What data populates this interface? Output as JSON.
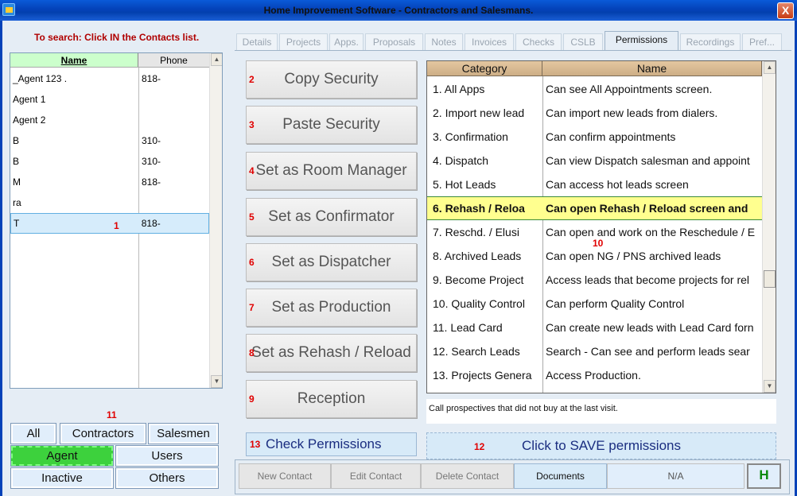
{
  "window": {
    "title": "Home Improvement Software - Contractors and Salesmans.",
    "close_label": "X"
  },
  "search_hint": "To search: Click IN the Contacts list.",
  "contacts": {
    "columns": [
      "Name",
      "Phone"
    ],
    "rows": [
      {
        "name": "_Agent 123 .",
        "phone": "818-"
      },
      {
        "name": "Agent 1",
        "phone": ""
      },
      {
        "name": "Agent 2",
        "phone": ""
      },
      {
        "name": "B",
        "phone": "310-"
      },
      {
        "name": "B",
        "phone": "310-"
      },
      {
        "name": "M",
        "phone": "818-"
      },
      {
        "name": "ra",
        "phone": ""
      },
      {
        "name": "T",
        "phone": "818-"
      }
    ],
    "selected_index": 7
  },
  "markers": {
    "m1": "1",
    "m2": "2",
    "m3": "3",
    "m4": "4",
    "m5": "5",
    "m6": "6",
    "m7": "7",
    "m8": "8",
    "m9": "9",
    "m10": "10",
    "m11": "11",
    "m12": "12",
    "m13": "13"
  },
  "filters": {
    "all": "All",
    "contractors": "Contractors",
    "salesmen": "Salesmen",
    "agent": "Agent",
    "users": "Users",
    "inactive": "Inactive",
    "others": "Others",
    "active": "Agent"
  },
  "tabs": [
    "Details",
    "Projects",
    "Apps.",
    "Proposals",
    "Notes",
    "Invoices",
    "Checks",
    "CSLB",
    "Permissions",
    "Recordings",
    "Pref..."
  ],
  "active_tab": "Permissions",
  "actions": [
    "Copy Security",
    "Paste Security",
    "Set as Room Manager",
    "Set as Confirmator",
    "Set as Dispatcher",
    "Set as Production",
    "Set as Rehash / Reload",
    "Reception"
  ],
  "check_permissions": "Check Permissions",
  "permissions": {
    "columns": [
      "Category",
      "Name"
    ],
    "rows": [
      {
        "category": "1. All Apps",
        "name": "Can see All Appointments screen."
      },
      {
        "category": "2. Import new lead",
        "name": "Can import new leads from dialers."
      },
      {
        "category": "3. Confirmation",
        "name": "Can confirm appointments"
      },
      {
        "category": "4. Dispatch",
        "name": "Can view Dispatch salesman and appoint"
      },
      {
        "category": "5. Hot Leads",
        "name": "Can access hot leads screen"
      },
      {
        "category": "6. Rehash / Reloa",
        "name": "Can open Rehash / Reload screen and"
      },
      {
        "category": "7. Reschd. / Elusi",
        "name": "Can open and work on the Reschedule / E"
      },
      {
        "category": "8. Archived Leads",
        "name": "Can open NG / PNS archived leads"
      },
      {
        "category": "9. Become Project",
        "name": "Access leads that become projects for rel"
      },
      {
        "category": "10. Quality Control",
        "name": "Can perform Quality Control"
      },
      {
        "category": "11. Lead Card",
        "name": "Can create new leads with Lead Card forn"
      },
      {
        "category": "12. Search Leads",
        "name": "Search - Can see and perform leads sear"
      },
      {
        "category": "13. Projects Genera",
        "name": "Access Production."
      }
    ],
    "selected_index": 5
  },
  "description": "Call prospectives that did not buy at the last visit.",
  "save_label": "Click to SAVE permissions",
  "bottom": {
    "new_contact": "New Contact",
    "edit_contact": "Edit Contact",
    "delete_contact": "Delete Contact",
    "documents": "Documents",
    "na": "N/A",
    "help": "H"
  }
}
